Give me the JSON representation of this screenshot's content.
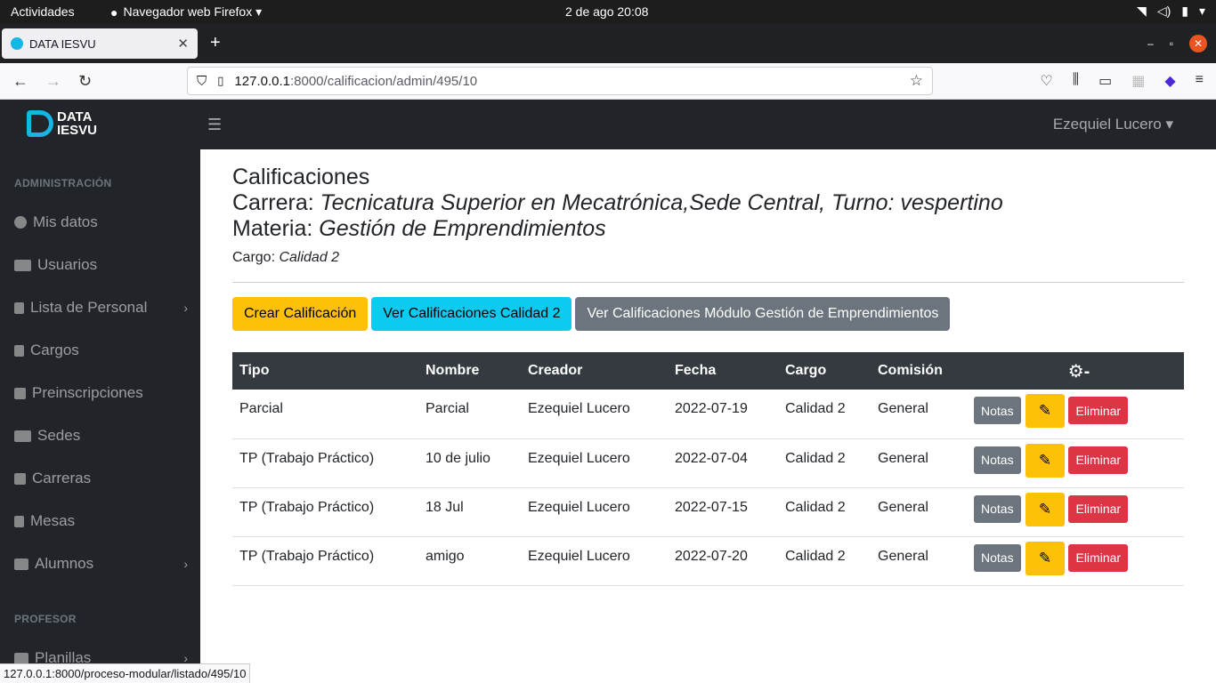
{
  "os": {
    "activities": "Actividades",
    "app_name": "Navegador web Firefox ▾",
    "clock": "2 de ago  20:08"
  },
  "browser": {
    "tab_title": "DATA IESVU",
    "url_host": "127.0.0.1",
    "url_path": ":8000/calificacion/admin/495/10",
    "status_url": "127.0.0.1:8000/proceso-modular/listado/495/10"
  },
  "sidebar": {
    "brand_line1": "DATA",
    "brand_line2": "IESVU",
    "section_admin": "ADMINISTRACIÓN",
    "section_prof": "PROFESOR",
    "items": [
      {
        "label": "Mis datos"
      },
      {
        "label": "Usuarios"
      },
      {
        "label": "Lista de Personal"
      },
      {
        "label": "Cargos"
      },
      {
        "label": "Preinscripciones"
      },
      {
        "label": "Sedes"
      },
      {
        "label": "Carreras"
      },
      {
        "label": "Mesas"
      },
      {
        "label": "Alumnos"
      },
      {
        "label": "Planillas"
      }
    ]
  },
  "header": {
    "user": "Ezequiel Lucero ▾"
  },
  "page": {
    "title": "Calificaciones",
    "carrera_label": "Carrera: ",
    "carrera_value": "Tecnicatura Superior en Mecatrónica,Sede Central, Turno: vespertino",
    "materia_label": "Materia: ",
    "materia_value": "Gestión de Emprendimientos",
    "cargo_label": "Cargo: ",
    "cargo_value": "Calidad 2",
    "btn_create": "Crear Calificación",
    "btn_view_cargo": "Ver Calificaciones Calidad 2",
    "btn_view_modulo": "Ver Calificaciones Módulo Gestión de Emprendimientos"
  },
  "table": {
    "headers": [
      "Tipo",
      "Nombre",
      "Creador",
      "Fecha",
      "Cargo",
      "Comisión",
      "⚙-"
    ],
    "action_labels": {
      "notas": "Notas",
      "edit": "✎",
      "delete": "Eliminar"
    },
    "rows": [
      {
        "tipo": "Parcial",
        "nombre": "Parcial",
        "creador": "Ezequiel Lucero",
        "fecha": "2022-07-19",
        "cargo": "Calidad 2",
        "comision": "General"
      },
      {
        "tipo": "TP (Trabajo Práctico)",
        "nombre": "10 de julio",
        "creador": "Ezequiel Lucero",
        "fecha": "2022-07-04",
        "cargo": "Calidad 2",
        "comision": "General"
      },
      {
        "tipo": "TP (Trabajo Práctico)",
        "nombre": "18 Jul",
        "creador": "Ezequiel Lucero",
        "fecha": "2022-07-15",
        "cargo": "Calidad 2",
        "comision": "General"
      },
      {
        "tipo": "TP (Trabajo Práctico)",
        "nombre": "amigo",
        "creador": "Ezequiel Lucero",
        "fecha": "2022-07-20",
        "cargo": "Calidad 2",
        "comision": "General"
      }
    ]
  }
}
